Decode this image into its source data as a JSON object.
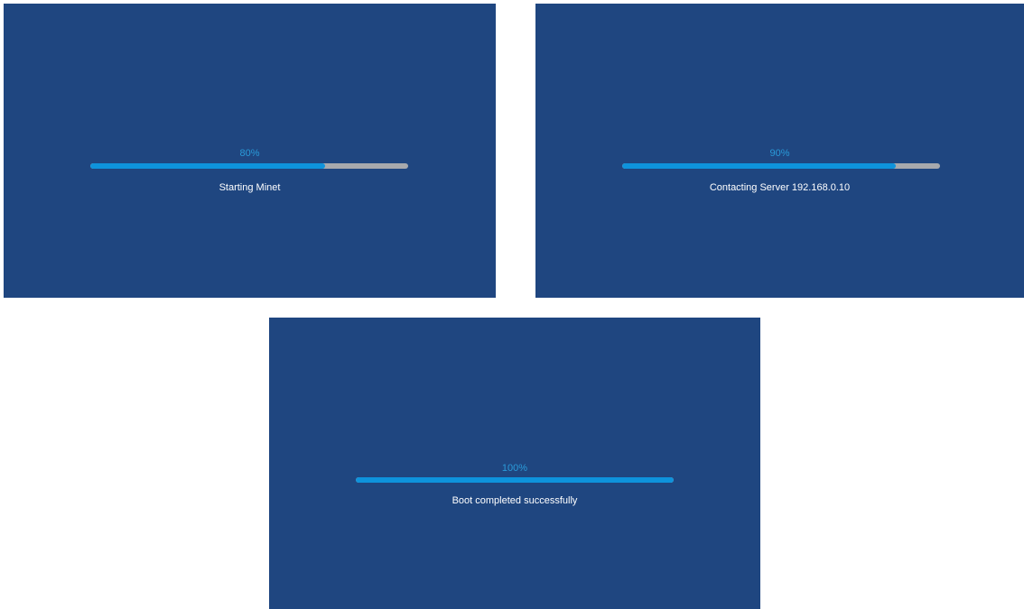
{
  "colors": {
    "screen_background": "#1f4680",
    "page_background": "#ffffff",
    "progress_fill": "#0e93dc",
    "progress_track": "#a7a9ad",
    "percent_text": "#2a9ad8",
    "status_text": "#ffffff"
  },
  "screens": [
    {
      "percent_label": "80%",
      "progress": 0.74,
      "status": "Starting Minet"
    },
    {
      "percent_label": "90%",
      "progress": 0.86,
      "status": "Contacting Server 192.168.0.10"
    },
    {
      "percent_label": "100%",
      "progress": 1.0,
      "status": "Boot completed successfully"
    }
  ]
}
